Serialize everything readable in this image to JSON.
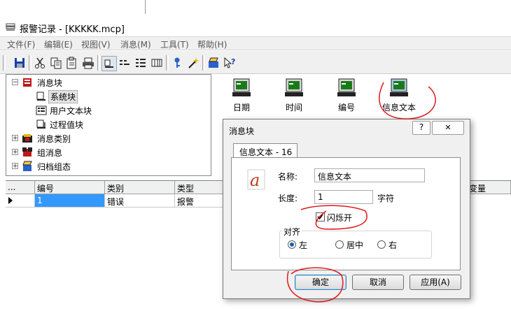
{
  "window": {
    "title": "报警记录 - [KKKKK.mcp]"
  },
  "menu": [
    "文件(F)",
    "编辑(E)",
    "视图(V)",
    "消息(M)",
    "工具(T)",
    "帮助(H)"
  ],
  "tree": {
    "root": "消息块",
    "items": [
      "系统块",
      "用户文本块",
      "过程值块",
      "消息类别",
      "组消息",
      "归档组态"
    ]
  },
  "blocks": [
    "日期",
    "时间",
    "编号",
    "信息文本"
  ],
  "grid": {
    "headers": [
      "...",
      "编号",
      "类别",
      "类型",
      "变量"
    ],
    "row": [
      "1",
      "错误",
      "报警"
    ]
  },
  "dialog": {
    "title": "消息块",
    "help": "?",
    "close": "✕",
    "tab": "信息文本 - 16",
    "name_label": "名称:",
    "name_value": "信息文本",
    "length_label": "长度:",
    "length_value": "1",
    "length_unit": "字符",
    "flash_label": "闪烁开",
    "flash_checked": true,
    "align_title": "对齐",
    "align_options": [
      "左",
      "居中",
      "右"
    ],
    "align_selected": "左",
    "ok": "确定",
    "cancel": "取消",
    "apply": "应用(A)"
  },
  "colors": {
    "selection": "#3399ff",
    "annotation": "#e0191c"
  }
}
